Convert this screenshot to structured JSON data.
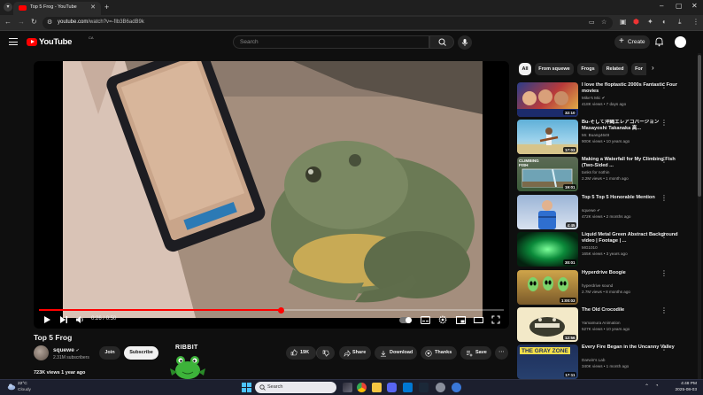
{
  "browser": {
    "tab_title": "Top 5 Frog - YouTube",
    "url_host": "youtube.com",
    "url_path": "/watch?v=-fIb3B6adB9k"
  },
  "masthead": {
    "logo_text": "YouTube",
    "logo_country": "CA",
    "search_placeholder": "Search",
    "create_label": "Create"
  },
  "player": {
    "current_time": "0:26",
    "duration": "0:50",
    "progress_fraction": 0.52
  },
  "video": {
    "title": "Top 5 Frog",
    "channel": "squewe",
    "subscribers": "2.31M subscribers",
    "join_label": "Join",
    "subscribe_label": "Subscribe",
    "likes": "19K",
    "share_label": "Share",
    "download_label": "Download",
    "thanks_label": "Thanks",
    "save_label": "Save",
    "views_line": "723K views  1 year ago",
    "overlay_text": "RIBBIT"
  },
  "chips": [
    "All",
    "From squewe",
    "Frogs",
    "Related",
    "For"
  ],
  "recommendations": [
    {
      "title": "I love the floptastic 2000s Fantastic Four movies",
      "channel": "Mike's Mic",
      "meta": "418K views • 7 days ago",
      "duration": "32:10"
    },
    {
      "title": "Bu-そして沖縄エレアコバージョン Masayoshi Takanaka 高...",
      "channel": "Mr. Buang4649",
      "meta": "900K views • 10 years ago",
      "duration": "17:03"
    },
    {
      "title": "Making a Waterfall for My Climbing Fish (Two-Sided ...",
      "channel": "tanks for nothin",
      "meta": "2.2M views • 1 month ago",
      "duration": "19:01",
      "thumb_text": "CLIMBING FISH"
    },
    {
      "title": "Top 5 Top 5 Honorable Mention",
      "channel": "squewe",
      "meta": "472K views • 2 months ago",
      "duration": "4:45"
    },
    {
      "title": "Liquid Metal Green Abstract Background video | Footage | ...",
      "channel": "MG1010",
      "meta": "165K views • 3 years ago",
      "duration": "30:01"
    },
    {
      "title": "Hyperdrive Boogie",
      "channel": "hyperdrive sound",
      "meta": "2.7M views • 8 months ago",
      "duration": "1:00:03"
    },
    {
      "title": "The Old Crocodile",
      "channel": "Yamamura Animation",
      "meta": "527K views • 10 years ago",
      "duration": "12:56"
    },
    {
      "title": "Every Fire Began in the Uncanny Valley",
      "channel": "Darwin's Lab",
      "meta": "340K views • 1 month ago",
      "duration": "17:11",
      "thumb_text": "THE GRAY ZONE"
    }
  ],
  "taskbar": {
    "temperature": "22°C",
    "condition": "Cloudy",
    "search_placeholder": "Search",
    "time": "4:48 PM",
    "date": "2025-08-03"
  }
}
